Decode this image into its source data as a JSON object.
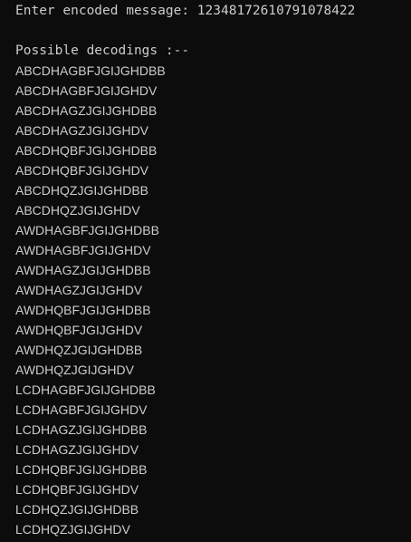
{
  "prompt": {
    "label": "Enter encoded message: ",
    "value": "12348172610791078422"
  },
  "header": "Possible decodings :--",
  "decodings": [
    "ABCDHAGBFJGIJGHDBB",
    "ABCDHAGBFJGIJGHDV",
    "ABCDHAGZJGIJGHDBB",
    "ABCDHAGZJGIJGHDV",
    "ABCDHQBFJGIJGHDBB",
    "ABCDHQBFJGIJGHDV",
    "ABCDHQZJGIJGHDBB",
    "ABCDHQZJGIJGHDV",
    "AWDHAGBFJGIJGHDBB",
    "AWDHAGBFJGIJGHDV",
    "AWDHAGZJGIJGHDBB",
    "AWDHAGZJGIJGHDV",
    "AWDHQBFJGIJGHDBB",
    "AWDHQBFJGIJGHDV",
    "AWDHQZJGIJGHDBB",
    "AWDHQZJGIJGHDV",
    "LCDHAGBFJGIJGHDBB",
    "LCDHAGBFJGIJGHDV",
    "LCDHAGZJGIJGHDBB",
    "LCDHAGZJGIJGHDV",
    "LCDHQBFJGIJGHDBB",
    "LCDHQBFJGIJGHDV",
    "LCDHQZJGIJGHDBB",
    "LCDHQZJGIJGHDV"
  ]
}
